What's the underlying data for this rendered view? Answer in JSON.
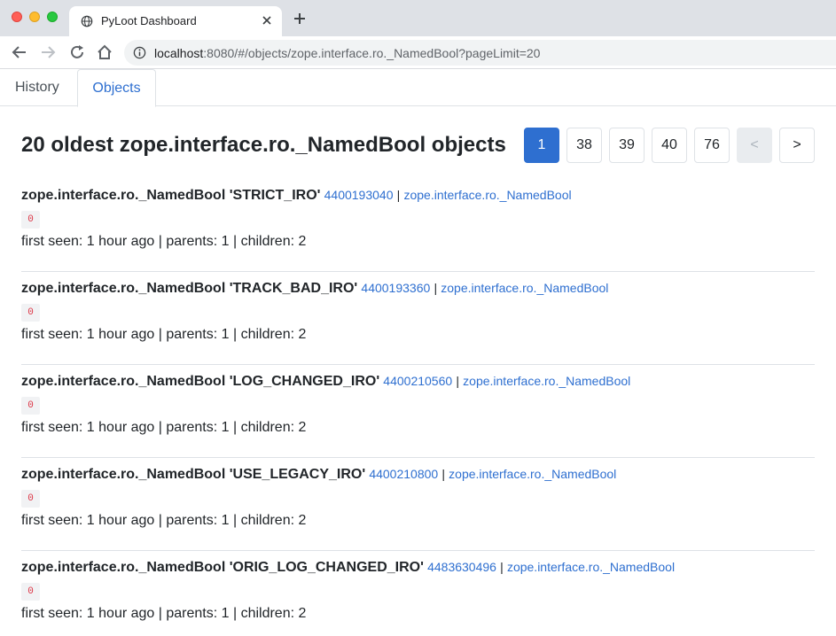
{
  "browser": {
    "tab_title": "PyLoot Dashboard",
    "url_host": "localhost",
    "url_rest": ":8080/#/objects/zope.interface.ro._NamedBool?pageLimit=20"
  },
  "nav": {
    "tabs": [
      {
        "label": "History",
        "active": false
      },
      {
        "label": "Objects",
        "active": true
      }
    ]
  },
  "main": {
    "title": "20 oldest zope.interface.ro._NamedBool objects",
    "pagination": [
      "1",
      "38",
      "39",
      "40",
      "76",
      "<",
      ">"
    ],
    "pagination_active": "1",
    "pagination_disabled": "<"
  },
  "objects": [
    {
      "name": "zope.interface.ro._NamedBool 'STRICT_IRO'",
      "id": "4400193040",
      "type": "zope.interface.ro._NamedBool",
      "badge": "0",
      "meta": "first seen: 1 hour ago | parents: 1 | children: 2"
    },
    {
      "name": "zope.interface.ro._NamedBool 'TRACK_BAD_IRO'",
      "id": "4400193360",
      "type": "zope.interface.ro._NamedBool",
      "badge": "0",
      "meta": "first seen: 1 hour ago | parents: 1 | children: 2"
    },
    {
      "name": "zope.interface.ro._NamedBool 'LOG_CHANGED_IRO'",
      "id": "4400210560",
      "type": "zope.interface.ro._NamedBool",
      "badge": "0",
      "meta": "first seen: 1 hour ago | parents: 1 | children: 2"
    },
    {
      "name": "zope.interface.ro._NamedBool 'USE_LEGACY_IRO'",
      "id": "4400210800",
      "type": "zope.interface.ro._NamedBool",
      "badge": "0",
      "meta": "first seen: 1 hour ago | parents: 1 | children: 2"
    },
    {
      "name": "zope.interface.ro._NamedBool 'ORIG_LOG_CHANGED_IRO'",
      "id": "4483630496",
      "type": "zope.interface.ro._NamedBool",
      "badge": "0",
      "meta": "first seen: 1 hour ago | parents: 1 | children: 2"
    }
  ],
  "separator": "|",
  "colors": {
    "accent": "#2e6fd0",
    "badge_text": "#dc3545"
  }
}
